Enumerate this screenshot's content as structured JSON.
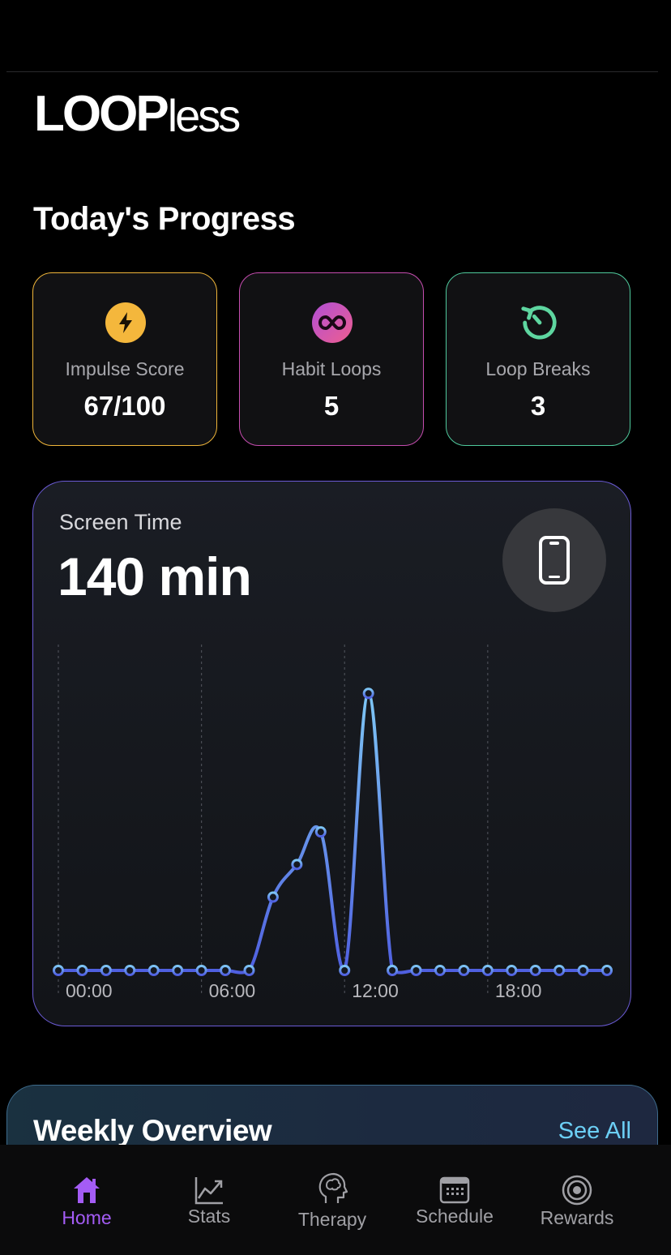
{
  "app": {
    "logo_bold": "LOOP",
    "logo_light": "less"
  },
  "progress": {
    "title": "Today's Progress",
    "cards": [
      {
        "label": "Impulse Score",
        "value": "67/100",
        "icon": "lightning-bolt-icon",
        "accent": "#f4b73c",
        "border": "#f0b63a"
      },
      {
        "label": "Habit Loops",
        "value": "5",
        "icon": "infinity-icon",
        "accent": "#d957b0",
        "border": "#c64db0"
      },
      {
        "label": "Loop Breaks",
        "value": "3",
        "icon": "restart-timer-icon",
        "accent": "#5ed6a0",
        "border": "#4fc99c"
      }
    ]
  },
  "screen_time": {
    "label": "Screen Time",
    "value": "140 min",
    "icon": "phone-icon"
  },
  "chart_data": {
    "type": "line",
    "x_tick_labels": [
      "00:00",
      "06:00",
      "12:00",
      "18:00"
    ],
    "x_range": [
      0,
      23
    ],
    "y_range": [
      0,
      40
    ],
    "grid": "vertical-dashed",
    "series": [
      {
        "x": [
          0,
          1,
          2,
          3,
          4,
          5,
          6,
          7,
          8,
          9,
          10,
          11,
          12,
          13,
          14,
          15,
          16,
          17,
          18,
          19,
          20,
          21,
          22,
          23
        ],
        "values": [
          0,
          0,
          0,
          0,
          0,
          0,
          0,
          0,
          0,
          9,
          13,
          17,
          0,
          34,
          0,
          0,
          0,
          0,
          0,
          0,
          0,
          0,
          0,
          0
        ],
        "color_start": "#4f5fe0",
        "color_end": "#7ec7f5"
      }
    ]
  },
  "weekly": {
    "title": "Weekly Overview",
    "see_all": "See All"
  },
  "tabs": [
    {
      "label": "Home",
      "icon": "home-icon",
      "active": true
    },
    {
      "label": "Stats",
      "icon": "chart-icon",
      "active": false
    },
    {
      "label": "Therapy",
      "icon": "brain-head-icon",
      "active": false
    },
    {
      "label": "Schedule",
      "icon": "calendar-icon",
      "active": false
    },
    {
      "label": "Rewards",
      "icon": "target-icon",
      "active": false
    }
  ]
}
